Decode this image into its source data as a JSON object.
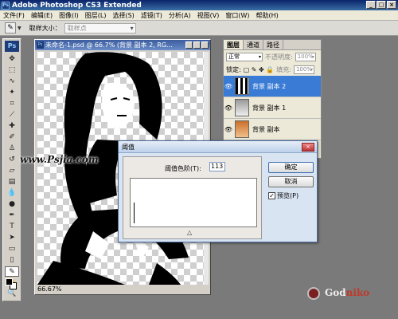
{
  "app": {
    "title": "Adobe Photoshop CS3 Extended",
    "ps_badge": "Ps"
  },
  "menu": [
    "文件(F)",
    "编辑(E)",
    "图像(I)",
    "图层(L)",
    "选择(S)",
    "滤镜(T)",
    "分析(A)",
    "视图(V)",
    "窗口(W)",
    "帮助(H)"
  ],
  "options_bar": {
    "tool_icon": "eyedropper-icon",
    "sample_size_label": "取样大小：",
    "sample_size_value": "取样点"
  },
  "toolbox": {
    "logo": "Ps"
  },
  "document": {
    "title": "未命名-1.psd @ 66.7% (背景 副本 2, RG...",
    "zoom": "66.67%"
  },
  "watermark": "www.Psjia.com",
  "layers_panel": {
    "tabs": [
      "图层",
      "通道",
      "路径"
    ],
    "blend_mode": "正常",
    "opacity_label": "不透明度:",
    "opacity_value": "100%",
    "lock_label": "锁定:",
    "fill_label": "填充:",
    "fill_value": "100%",
    "layers": [
      {
        "name": "背景 副本 2",
        "selected": true
      },
      {
        "name": "背景 副本 1",
        "selected": false
      },
      {
        "name": "背景 副本",
        "selected": false
      }
    ]
  },
  "threshold_dialog": {
    "title": "阈值",
    "level_label": "阈值色阶(T):",
    "level_value": "113",
    "ok_label": "确定",
    "cancel_label": "取消",
    "preview_label": "预览(P)",
    "preview_checked": true
  },
  "brand_logo": {
    "text_main": "God",
    "text_accent": "niko"
  }
}
